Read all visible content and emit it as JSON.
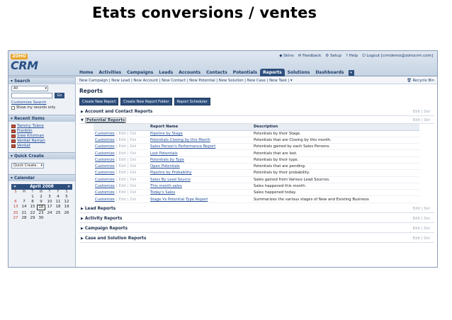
{
  "slide_title": "Etats conversions / ventes",
  "logo": {
    "top": "ZOHO",
    "main": "CRM"
  },
  "top_links": [
    "Skins",
    "Feedback",
    "Setup",
    "Help",
    "Logout [crmdemo@zohocrm.com]"
  ],
  "tabs": [
    "Home",
    "Activities",
    "Campaigns",
    "Leads",
    "Accounts",
    "Contacts",
    "Potentials",
    "Reports",
    "Solutions",
    "Dashboards"
  ],
  "active_tab": "Reports",
  "quick_bar": "New Campaign | New Lead | New Account | New Contact | New Potential | New Solution | New Case | New Task | ▾",
  "recycle_bin": "Recycle Bin",
  "sidebar": {
    "search": {
      "header": "Search",
      "select_value": "All",
      "go": "Go",
      "customize": "Customize Search",
      "show_mine": "Show my records only"
    },
    "recent": {
      "header": "Recent Items",
      "items": [
        "Tammy Tubne",
        "Franklin",
        "Sree Krishnan",
        "Venkat Raman",
        "Venkat"
      ]
    },
    "quick_create": {
      "header": "Quick Create",
      "value": "Quick Create.."
    },
    "calendar": {
      "header": "Calendar",
      "month": "April 2008",
      "prev": "«",
      "next": "»",
      "dow": [
        "S",
        "M",
        "T",
        "W",
        "T",
        "F",
        "S"
      ],
      "days": [
        "",
        "",
        "1",
        "2",
        "3",
        "4",
        "5",
        "6",
        "7",
        "8",
        "9",
        "10",
        "11",
        "12",
        "13",
        "14",
        "15",
        "16",
        "17",
        "18",
        "19",
        "20",
        "21",
        "22",
        "23",
        "24",
        "25",
        "26",
        "27",
        "28",
        "29",
        "30",
        "",
        "",
        ""
      ],
      "today": "16"
    }
  },
  "main": {
    "title": "Reports",
    "buttons": [
      "Create New Report",
      "Create New Report Folder",
      "Report Scheduler"
    ],
    "edit": "Edit",
    "del": "Del",
    "sections_before": [
      "Account and Contact Reports"
    ],
    "expanded_section": "Potential Reports",
    "columns": [
      "Report Name",
      "Description"
    ],
    "row_customize": "Customize",
    "row_edit": "Edit",
    "row_del": "Del",
    "rows": [
      {
        "name": "Pipeline by Stage",
        "desc": "Potentials by their Stage."
      },
      {
        "name": "Potentials Closing by this Month",
        "desc": "Potentials that are Closing by this month."
      },
      {
        "name": "Sales Person's Performance Report",
        "desc": "Potentials gained by each Sales Persons."
      },
      {
        "name": "Lost Potentials",
        "desc": "Potentials that are lost."
      },
      {
        "name": "Potentials by Type",
        "desc": "Potentials by their type."
      },
      {
        "name": "Open Potentials",
        "desc": "Potentials that are pending."
      },
      {
        "name": "Pipeline by Probability",
        "desc": "Potentials by their probability."
      },
      {
        "name": "Sales By Lead Source",
        "desc": "Sales gained from Various Lead Sources."
      },
      {
        "name": "This month sales",
        "desc": "Sales happened this month."
      },
      {
        "name": "Today's Sales",
        "desc": "Sales happened today."
      },
      {
        "name": "Stage Vs Potential Type Report",
        "desc": "Summarizes the various stages of New and Existing Business"
      }
    ],
    "sections_after": [
      "Lead Reports",
      "Activity Reports",
      "Campaign Reports",
      "Case and Solution Reports"
    ]
  }
}
